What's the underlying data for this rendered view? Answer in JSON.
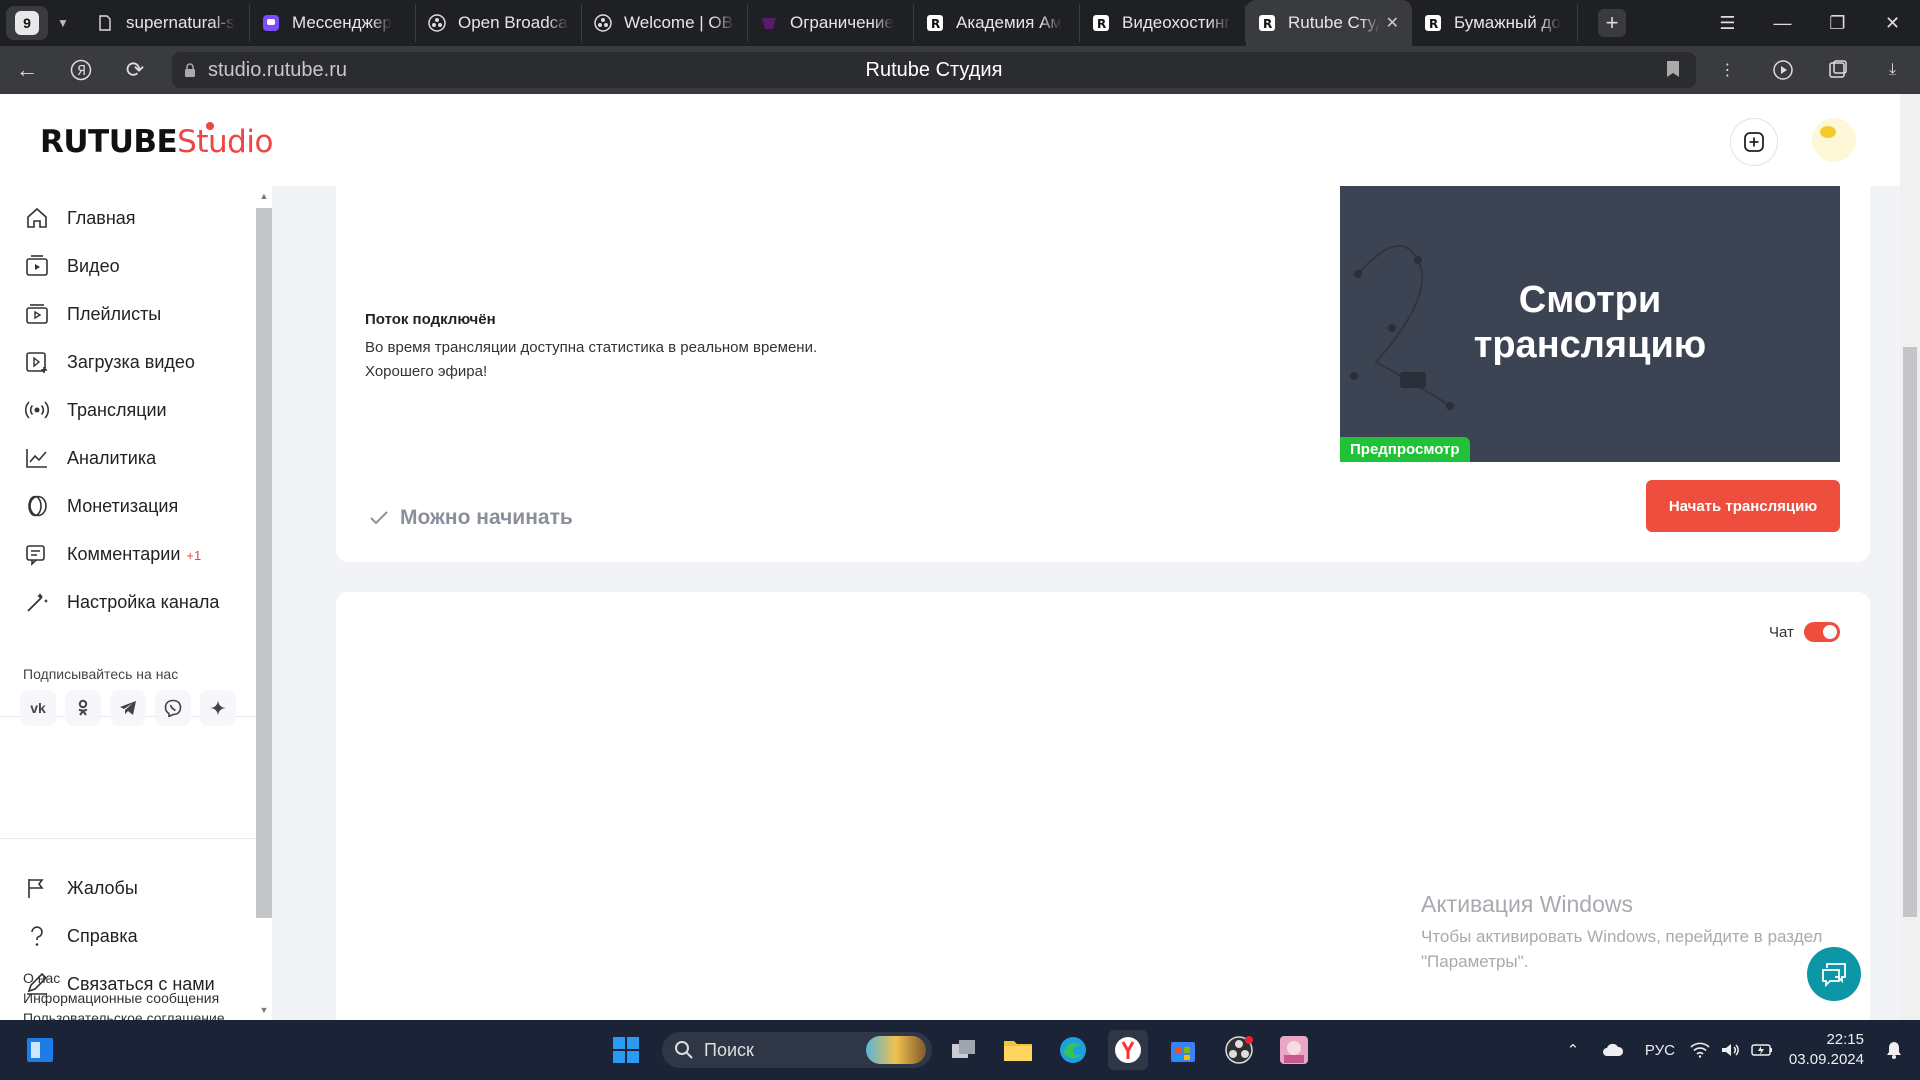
{
  "browser": {
    "tab_count": "9",
    "tabs": [
      {
        "label": "supernatural-s",
        "icon": "doc-icon"
      },
      {
        "label": "Мессенджер",
        "icon": "messenger-icon"
      },
      {
        "label": "Open Broadcas",
        "icon": "obs-icon"
      },
      {
        "label": "Welcome | OBS",
        "icon": "obs-icon"
      },
      {
        "label": "Ограничение",
        "icon": "mask-icon"
      },
      {
        "label": "Академия Ам",
        "icon": "rutube-icon"
      },
      {
        "label": "Видеохостинг",
        "icon": "rutube-icon"
      },
      {
        "label": "Rutube Студ",
        "icon": "rutube-icon",
        "active": true
      },
      {
        "label": "Бумажный до",
        "icon": "rutube-icon"
      }
    ],
    "url": "studio.rutube.ru",
    "page_title": "Rutube Студия"
  },
  "header": {
    "logo_main": "RUTUBE",
    "logo_sub": "Studio"
  },
  "sidebar": {
    "items": [
      {
        "label": "Главная",
        "icon": "home-icon"
      },
      {
        "label": "Видео",
        "icon": "video-icon"
      },
      {
        "label": "Плейлисты",
        "icon": "playlist-icon"
      },
      {
        "label": "Загрузка видео",
        "icon": "upload-icon"
      },
      {
        "label": "Трансляции",
        "icon": "broadcast-icon"
      },
      {
        "label": "Аналитика",
        "icon": "analytics-icon"
      },
      {
        "label": "Монетизация",
        "icon": "monetization-icon"
      },
      {
        "label": "Комментарии",
        "icon": "comments-icon",
        "badge": "+1"
      },
      {
        "label": "Настройка канала",
        "icon": "settings-wand-icon"
      }
    ],
    "follow_title": "Подписывайтесь на нас",
    "socials": [
      "vk",
      "ok",
      "telegram",
      "viber",
      "zen"
    ],
    "bottom_items": [
      {
        "label": "Жалобы",
        "icon": "flag-icon"
      },
      {
        "label": "Справка",
        "icon": "help-icon"
      },
      {
        "label": "Связаться с нами",
        "icon": "contact-icon"
      }
    ],
    "footer_links": [
      "О нас",
      "Информационные сообщения",
      "Пользовательское соглашение"
    ]
  },
  "stream": {
    "status_title": "Поток подключён",
    "status_text_1": "Во время трансляции доступна статистика в реальном времени.",
    "status_text_2": "Хорошего эфира!",
    "ready_text": "Можно начинать",
    "preview_line_1": "Смотри",
    "preview_line_2": "трансляцию",
    "preview_badge": "Предпросмотр",
    "start_button": "Начать трансляцию"
  },
  "chat": {
    "label": "Чат",
    "enabled": true
  },
  "watermark": {
    "title": "Активация Windows",
    "line1": "Чтобы активировать Windows, перейдите в раздел",
    "line2": "\"Параметры\"."
  },
  "taskbar": {
    "search_placeholder": "Поиск",
    "language": "РУС",
    "time": "22:15",
    "date": "03.09.2024"
  },
  "colors": {
    "accent": "#ee4e3d",
    "preview_bg": "#3c4352",
    "badge_green": "#21c138",
    "help_fab": "#0c96a6"
  }
}
